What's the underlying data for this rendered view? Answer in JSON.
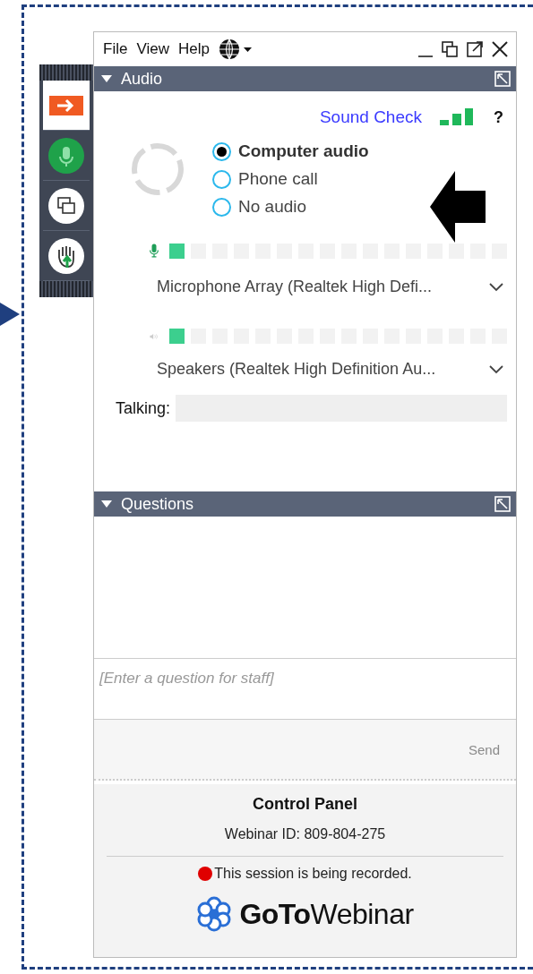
{
  "menu": [
    "File",
    "View",
    "Help"
  ],
  "toolbar": [
    {
      "kind": "exit",
      "selected": true
    },
    {
      "kind": "microphone",
      "selected": false
    },
    {
      "kind": "screens",
      "selected": false
    },
    {
      "kind": "hand",
      "selected": false
    }
  ],
  "audio": {
    "title": "Audio",
    "expanded": true,
    "sound_check": "Sound Check",
    "help": "?",
    "options": [
      {
        "label": "Computer audio",
        "selected": true
      },
      {
        "label": "Phone call",
        "selected": false
      },
      {
        "label": "No audio",
        "selected": false
      }
    ],
    "microphone": {
      "level": 0.06,
      "device": "Microphone Array (Realtek High Defi..."
    },
    "speakers": {
      "level": 0.06,
      "device": "Speakers (Realtek High Definition Au..."
    },
    "talking_label": "Talking:"
  },
  "questions": {
    "title": "Questions",
    "expanded": true,
    "placeholder": "[Enter a question for staff]",
    "send": "Send",
    "send_disabled": true
  },
  "control_panel": {
    "title": "Control Panel",
    "webinar_id": "Webinar ID: 809-804-275",
    "recording": "This session is being recorded.",
    "logo": "**GoTo**Webinar"
  }
}
